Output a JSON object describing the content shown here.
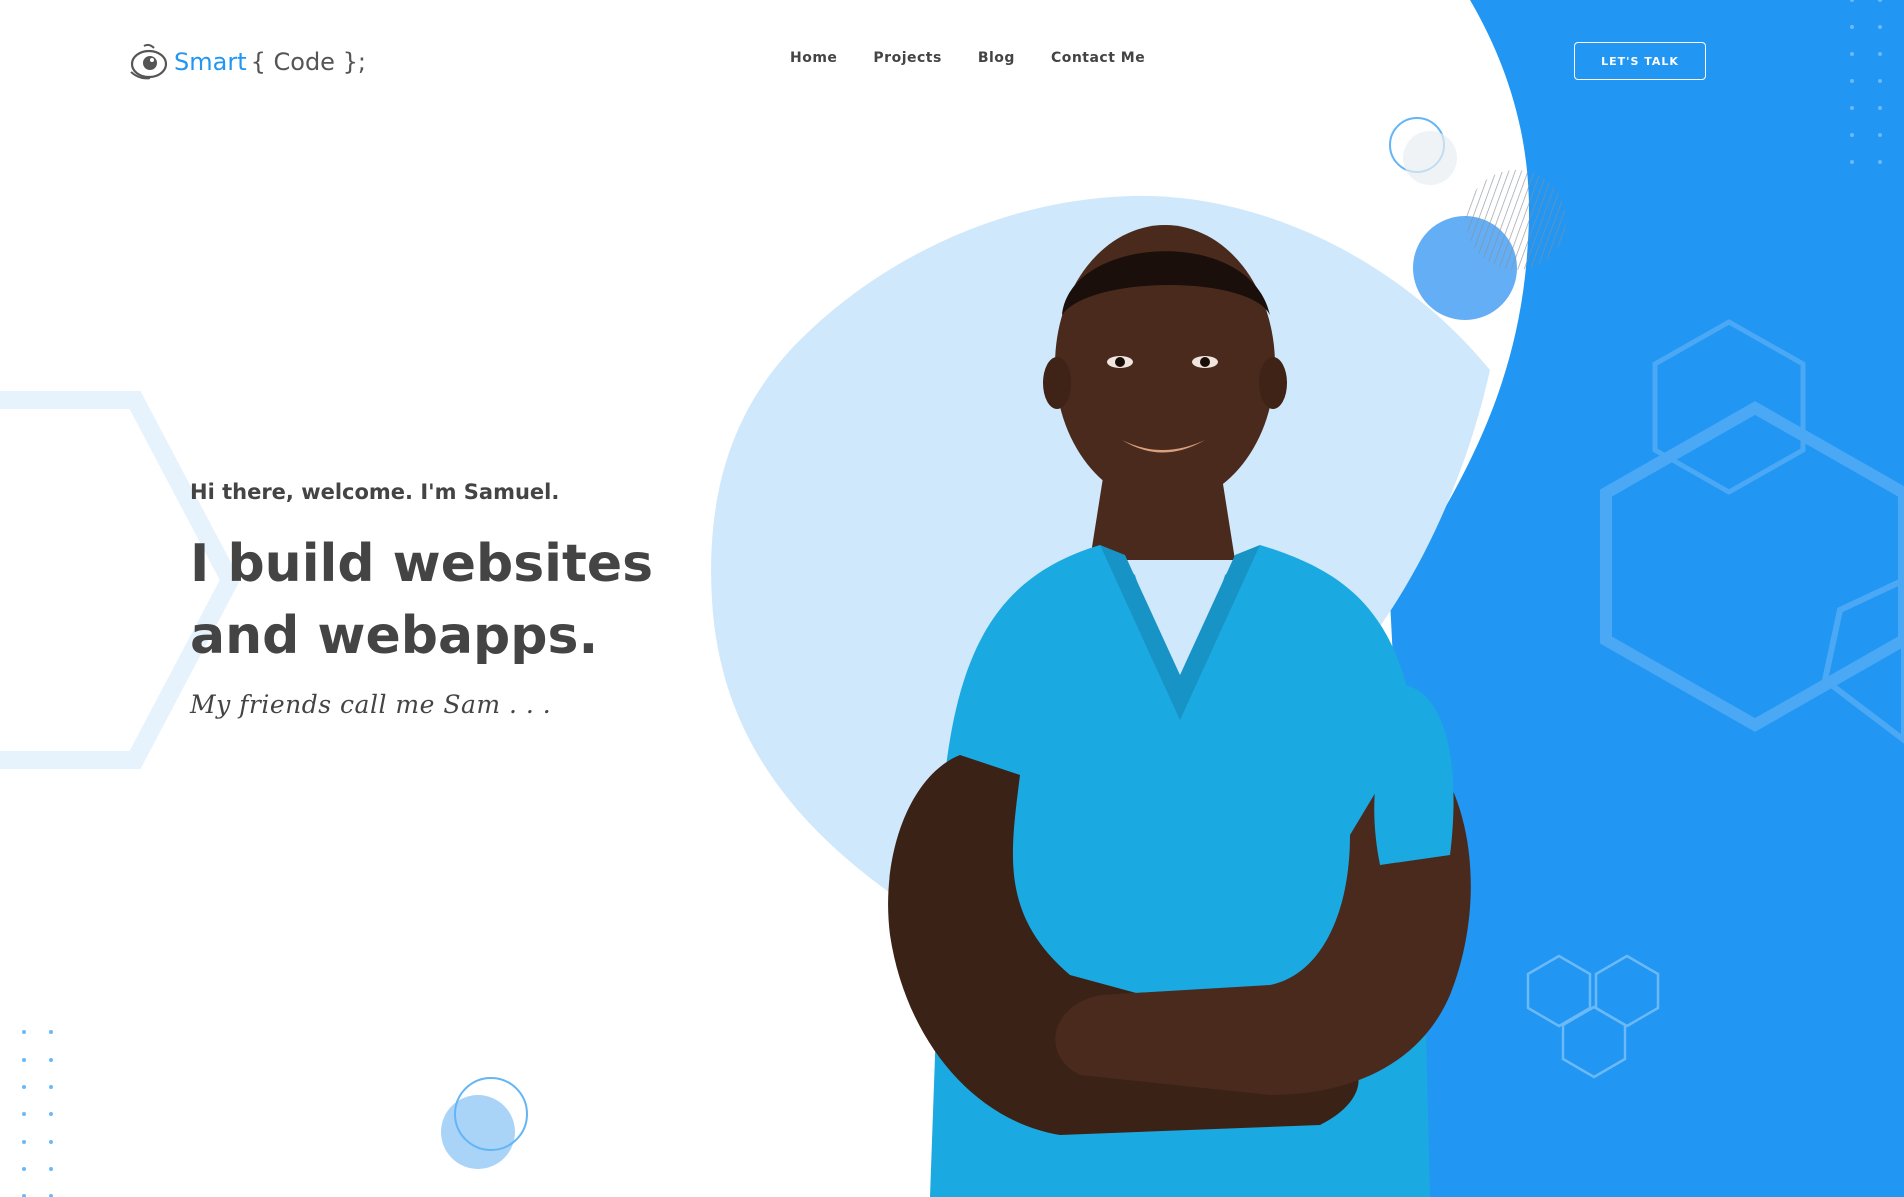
{
  "brand": {
    "name_primary": "Smart",
    "name_secondary": "{ Code };",
    "accent_color": "#2196f3",
    "text_color": "#444444",
    "light_blue": "#cfe8fb"
  },
  "nav": {
    "items": [
      {
        "label": "Home"
      },
      {
        "label": "Projects"
      },
      {
        "label": "Blog"
      },
      {
        "label": "Contact Me"
      }
    ]
  },
  "header": {
    "cta_label": "LET'S TALK"
  },
  "hero": {
    "greeting": "Hi there, welcome. I'm Samuel.",
    "headline": "I build websites and webapps.",
    "tagline": "My friends call me Sam . . ."
  },
  "icons": {
    "logo": "eye-logo-icon"
  }
}
